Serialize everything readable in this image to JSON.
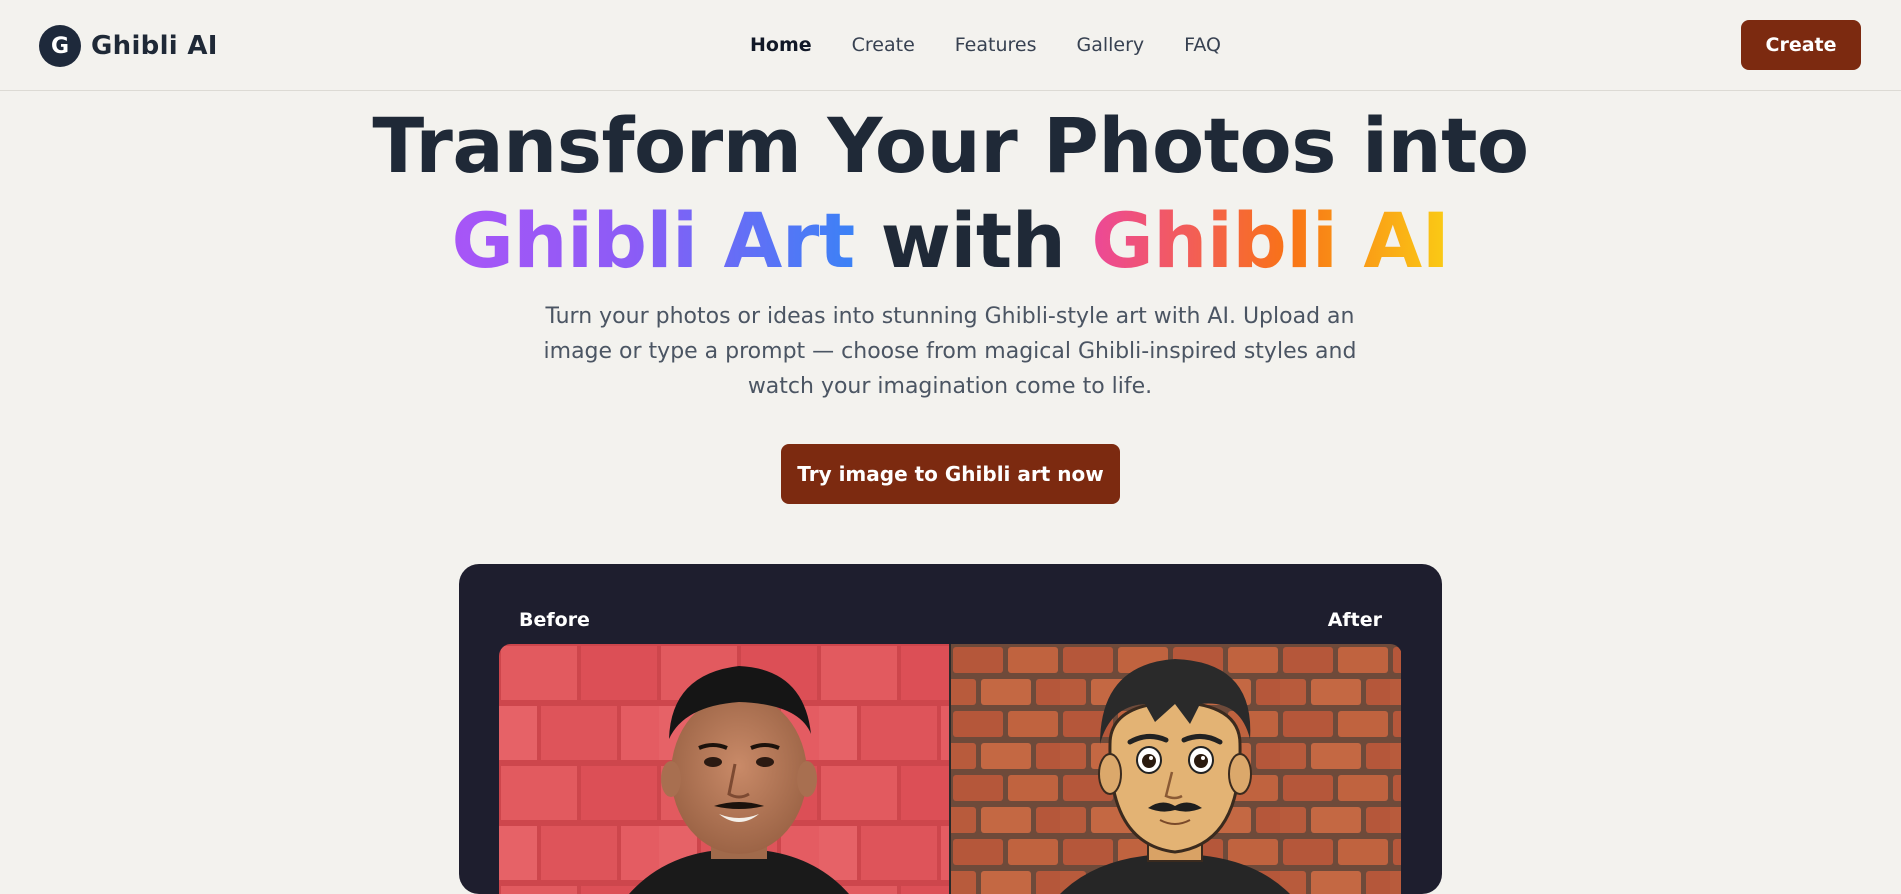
{
  "brand": {
    "logo_letter": "G",
    "name": "Ghibli AI"
  },
  "nav": {
    "items": [
      {
        "label": "Home",
        "active": true
      },
      {
        "label": "Create",
        "active": false
      },
      {
        "label": "Features",
        "active": false
      },
      {
        "label": "Gallery",
        "active": false
      },
      {
        "label": "FAQ",
        "active": false
      }
    ]
  },
  "header": {
    "cta_label": "Create"
  },
  "hero": {
    "title_line1": "Transform Your Photos into",
    "title_part_a": "Ghibli Art",
    "title_part_b": "with",
    "title_part_c": "Ghibli AI",
    "subtitle": "Turn your photos or ideas into stunning Ghibli-style art with AI. Upload an image or type a prompt — choose from magical Ghibli-inspired styles and watch your imagination come to life.",
    "cta_label": "Try image to Ghibli art now"
  },
  "compare": {
    "before_label": "Before",
    "after_label": "After"
  },
  "colors": {
    "accent": "#7c2a10",
    "panel_bg": "#1e1e2e",
    "page_bg": "#f3f2ee",
    "gradient_purple": [
      "#a855f7",
      "#3b82f6"
    ],
    "gradient_warm": [
      "#ec4899",
      "#f97316",
      "#facc15"
    ]
  }
}
